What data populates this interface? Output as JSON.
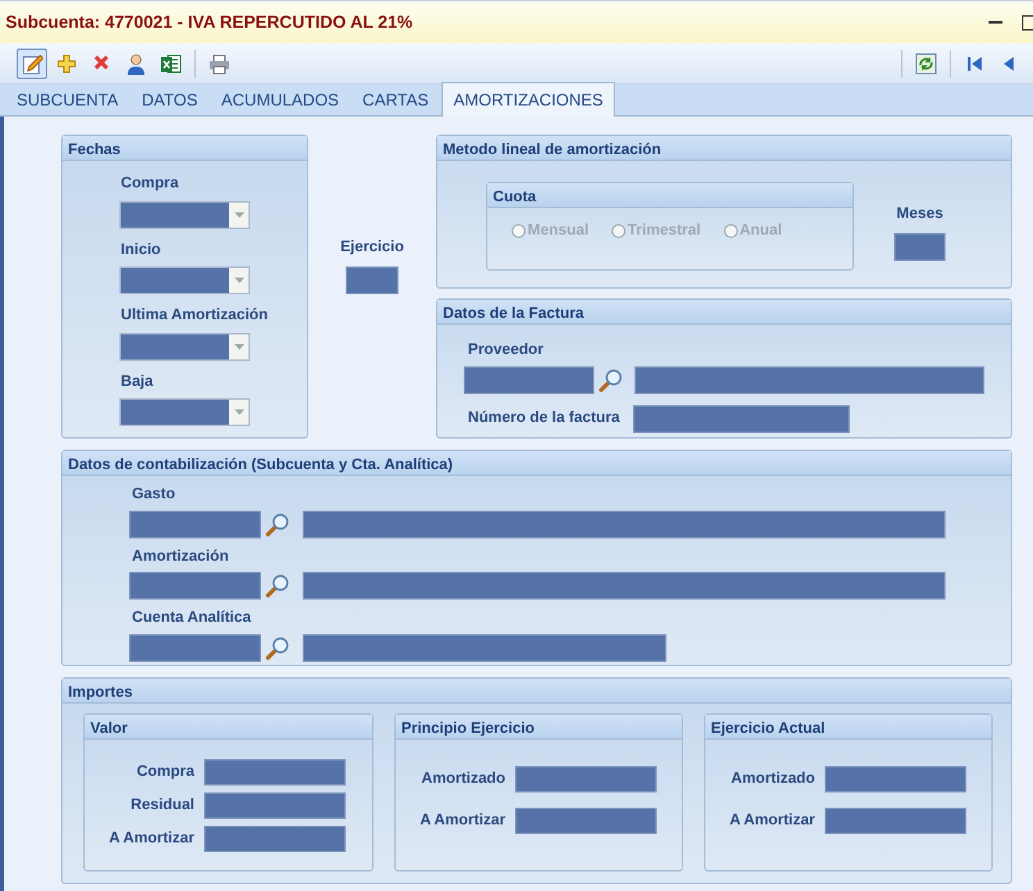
{
  "window": {
    "title": "Subcuenta: 4770021 - IVA REPERCUTIDO AL 21%"
  },
  "toolbar": {
    "left": [
      {
        "kind": "edit",
        "selected": true
      },
      {
        "kind": "add",
        "selected": false
      },
      {
        "kind": "delete",
        "selected": false
      },
      {
        "kind": "user",
        "selected": false
      },
      {
        "kind": "excel",
        "selected": false
      },
      {
        "kind": "print",
        "selected": false
      }
    ],
    "right": [
      {
        "kind": "refresh",
        "selected": false
      },
      {
        "kind": "first",
        "selected": false
      },
      {
        "kind": "prev",
        "selected": false
      }
    ]
  },
  "tabs": [
    {
      "label": "SUBCUENTA",
      "selected": false
    },
    {
      "label": "DATOS",
      "selected": false
    },
    {
      "label": "ACUMULADOS",
      "selected": false
    },
    {
      "label": "CARTAS",
      "selected": false
    },
    {
      "label": "AMORTIZACIONES",
      "selected": true
    }
  ],
  "fechas": {
    "title": "Fechas",
    "fields": [
      {
        "label": "Compra"
      },
      {
        "label": "Inicio"
      },
      {
        "label": "Ultima Amortización"
      },
      {
        "label": "Baja"
      }
    ]
  },
  "ejercicio": {
    "label": "Ejercicio"
  },
  "metodo": {
    "title": "Metodo lineal de amortización",
    "cuota": {
      "title": "Cuota",
      "options": [
        {
          "label": "Mensual",
          "selected": false,
          "disabled": true
        },
        {
          "label": "Trimestral",
          "selected": false,
          "disabled": true
        },
        {
          "label": "Anual",
          "selected": false,
          "disabled": true
        }
      ]
    },
    "meses": {
      "label": "Meses"
    }
  },
  "factura": {
    "title": "Datos de la Factura",
    "proveedor": {
      "label": "Proveedor"
    },
    "numero": {
      "label": "Número de la factura"
    }
  },
  "contabilizacion": {
    "title": "Datos de contabilización (Subcuenta y Cta. Analítica)",
    "rows": [
      {
        "label": "Gasto"
      },
      {
        "label": "Amortización"
      },
      {
        "label": "Cuenta Analítica"
      }
    ]
  },
  "importes": {
    "title": "Importes",
    "groups": [
      {
        "title": "Valor",
        "fields": [
          {
            "label": "Compra"
          },
          {
            "label": "Residual"
          },
          {
            "label": "A Amortizar"
          }
        ]
      },
      {
        "title": "Principio Ejercicio",
        "fields": [
          {
            "label": "Amortizado"
          },
          {
            "label": "A Amortizar"
          }
        ]
      },
      {
        "title": "Ejercicio Actual",
        "fields": [
          {
            "label": "Amortizado"
          },
          {
            "label": "A Amortizar"
          }
        ]
      }
    ]
  }
}
